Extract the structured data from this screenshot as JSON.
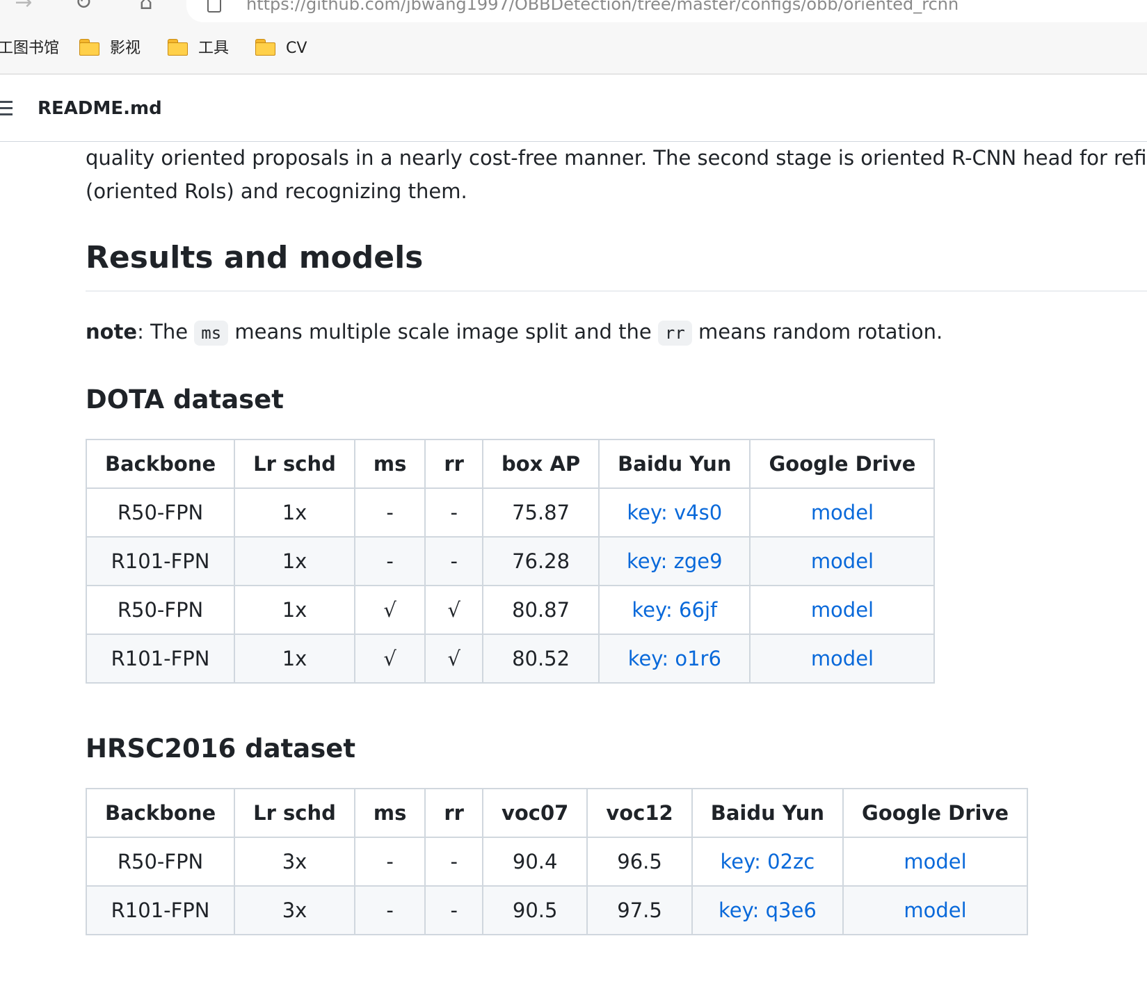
{
  "browser": {
    "url": "https://github.com/jbwang1997/OBBDetection/tree/master/configs/obb/oriented_rcnn",
    "bookmarks": [
      {
        "label": "工图书馆",
        "has_folder_icon": false
      },
      {
        "label": "影视",
        "has_folder_icon": true
      },
      {
        "label": "工具",
        "has_folder_icon": true
      },
      {
        "label": "CV",
        "has_folder_icon": true
      }
    ]
  },
  "file_header": {
    "file_name": "README.md"
  },
  "readme": {
    "intro_line1": "quality oriented proposals in a nearly cost-free manner. The second stage is oriented R-CNN head for refinin",
    "intro_line2": "(oriented RoIs) and recognizing them.",
    "results_heading": "Results and models",
    "note": {
      "bold": "note",
      "text1": ": The ",
      "code1": "ms",
      "text2": " means multiple scale image split and the ",
      "code2": "rr",
      "text3": " means random rotation."
    },
    "dota": {
      "heading": "DOTA dataset",
      "headers": [
        "Backbone",
        "Lr schd",
        "ms",
        "rr",
        "box AP",
        "Baidu Yun",
        "Google Drive"
      ],
      "rows": [
        [
          "R50-FPN",
          "1x",
          "-",
          "-",
          "75.87",
          "key: v4s0",
          "model"
        ],
        [
          "R101-FPN",
          "1x",
          "-",
          "-",
          "76.28",
          "key: zge9",
          "model"
        ],
        [
          "R50-FPN",
          "1x",
          "√",
          "√",
          "80.87",
          "key: 66jf",
          "model"
        ],
        [
          "R101-FPN",
          "1x",
          "√",
          "√",
          "80.52",
          "key: o1r6",
          "model"
        ]
      ]
    },
    "hrsc": {
      "heading": "HRSC2016 dataset",
      "headers": [
        "Backbone",
        "Lr schd",
        "ms",
        "rr",
        "voc07",
        "voc12",
        "Baidu Yun",
        "Google Drive"
      ],
      "rows": [
        [
          "R50-FPN",
          "3x",
          "-",
          "-",
          "90.4",
          "96.5",
          "key: 02zc",
          "model"
        ],
        [
          "R101-FPN",
          "3x",
          "-",
          "-",
          "90.5",
          "97.5",
          "key: q3e6",
          "model"
        ]
      ]
    }
  },
  "colors": {
    "link": "#0969da",
    "table_border": "#d0d7de",
    "row_alt": "#f6f8fa",
    "text": "#1f2328"
  }
}
